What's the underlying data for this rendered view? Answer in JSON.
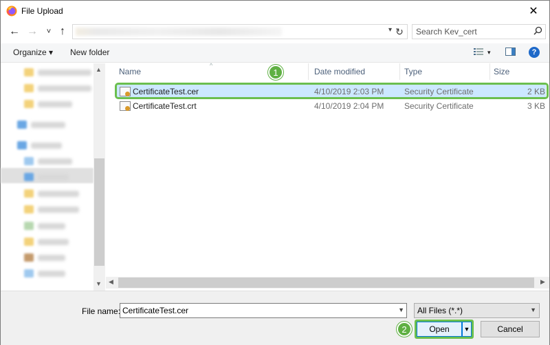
{
  "window": {
    "title": "File Upload",
    "close_glyph": "✕",
    "app_icon": "firefox-icon"
  },
  "nav": {
    "back_glyph": "←",
    "forward_glyph": "→",
    "recent_glyph": "˅",
    "up_glyph": "↑",
    "refresh_glyph": "↻",
    "address_dropdown_glyph": "▾"
  },
  "search": {
    "placeholder": "Search Kev_cert",
    "icon": "search-icon"
  },
  "toolbar": {
    "organize_label": "Organize ▾",
    "new_folder_label": "New folder",
    "view_icon": "view-options-icon",
    "view_dd": "▾",
    "preview_icon": "preview-pane-icon",
    "help_label": "?"
  },
  "columns": {
    "name": "Name",
    "date": "Date modified",
    "type": "Type",
    "size": "Size"
  },
  "files": [
    {
      "name": "CertificateTest.cer",
      "date": "4/10/2019 2:03 PM",
      "type": "Security Certificate",
      "size": "2 KB",
      "selected": true
    },
    {
      "name": "CertificateTest.crt",
      "date": "4/10/2019 2:04 PM",
      "type": "Security Certificate",
      "size": "3 KB",
      "selected": false
    }
  ],
  "callouts": {
    "step1": "1",
    "step2": "2"
  },
  "bottom": {
    "file_name_label": "File name:",
    "file_name_value": "CertificateTest.cer",
    "file_type_value": "All Files (*.*)",
    "open_label": "Open",
    "split_glyph": "▾",
    "cancel_label": "Cancel"
  },
  "colors": {
    "highlight_green": "#6bbf4e",
    "selection_blue": "#cce8ff",
    "accent_blue": "#0078d7"
  }
}
